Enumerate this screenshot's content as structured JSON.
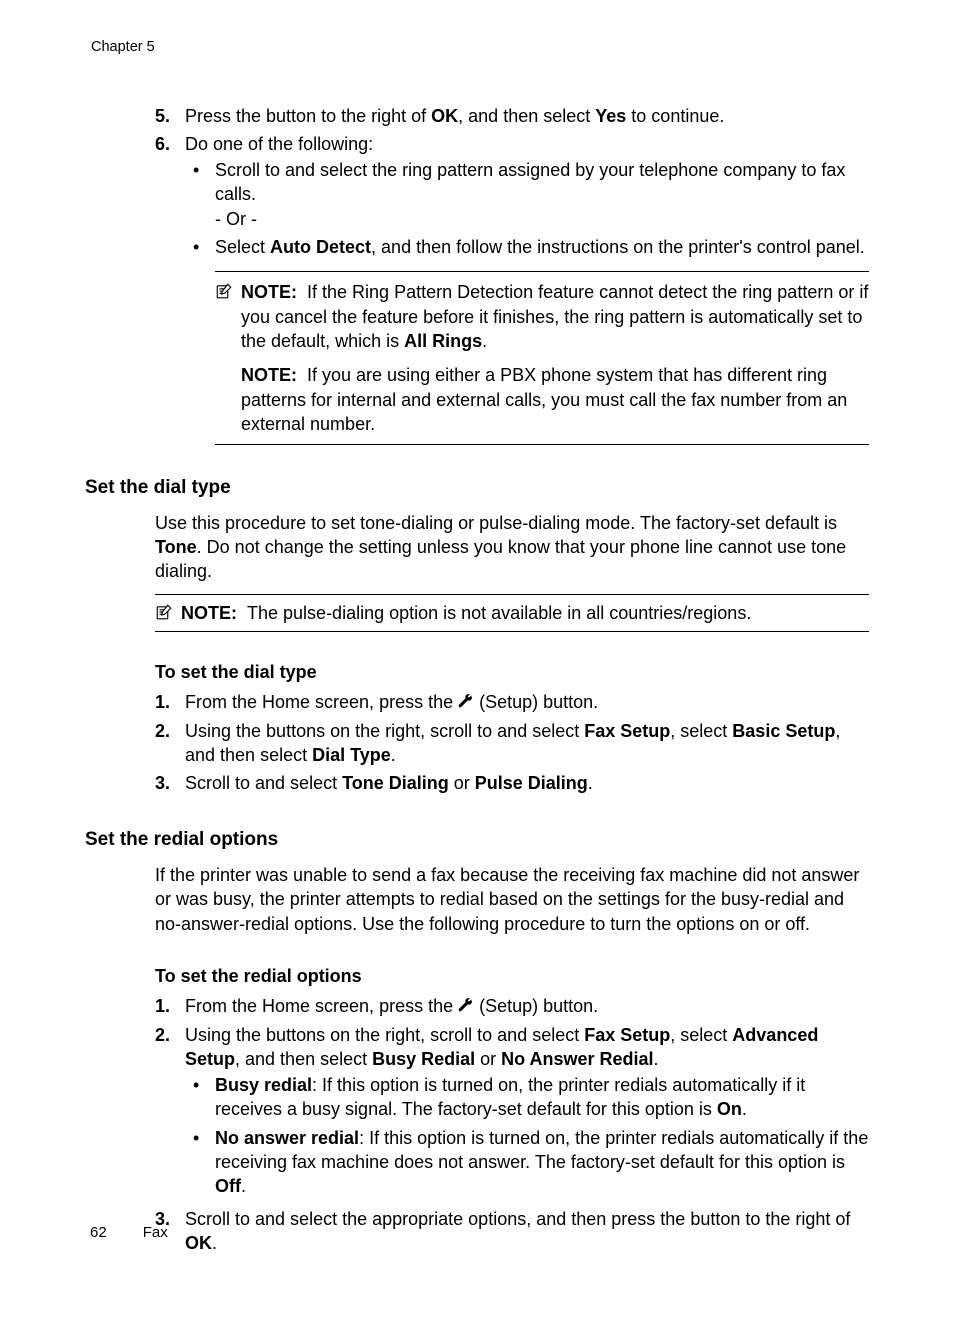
{
  "chapter": "Chapter 5",
  "steps_top": {
    "s5_num": "5.",
    "s5_a": "Press the button to the right of ",
    "s5_b": "OK",
    "s5_c": ", and then select ",
    "s5_d": "Yes",
    "s5_e": " to continue.",
    "s6_num": "6.",
    "s6_a": "Do one of the following:",
    "s6_b1": "Scroll to and select the ring pattern assigned by your telephone company to fax calls.",
    "s6_or": "- Or -",
    "s6_b2a": "Select ",
    "s6_b2b": "Auto Detect",
    "s6_b2c": ", and then follow the instructions on the printer's control panel."
  },
  "note1": {
    "label1": "NOTE:",
    "p1a": "If the Ring Pattern Detection feature cannot detect the ring pattern or if you cancel the feature before it finishes, the ring pattern is automatically set to the default, which is ",
    "p1b": "All Rings",
    "p1c": ".",
    "label2": "NOTE:",
    "p2": "If you are using either a PBX phone system that has different ring patterns for internal and external calls, you must call the fax number from an external number."
  },
  "dial": {
    "heading": "Set the dial type",
    "intro_a": "Use this procedure to set tone-dialing or pulse-dialing mode. The factory-set default is ",
    "intro_b": "Tone",
    "intro_c": ". Do not change the setting unless you know that your phone line cannot use tone dialing.",
    "note_label": "NOTE:",
    "note_text": "The pulse-dialing option is not available in all countries/regions.",
    "proc_title": "To set the dial type",
    "s1_num": "1.",
    "s1_a": "From the Home screen, press the ",
    "s1_b": " (Setup) button.",
    "s2_num": "2.",
    "s2_a": "Using the buttons on the right, scroll to and select ",
    "s2_b": "Fax Setup",
    "s2_c": ", select ",
    "s2_d": "Basic Setup",
    "s2_e": ", and then select ",
    "s2_f": "Dial Type",
    "s2_g": ".",
    "s3_num": "3.",
    "s3_a": "Scroll to and select ",
    "s3_b": "Tone Dialing",
    "s3_c": " or ",
    "s3_d": "Pulse Dialing",
    "s3_e": "."
  },
  "redial": {
    "heading": "Set the redial options",
    "intro": "If the printer was unable to send a fax because the receiving fax machine did not answer or was busy, the printer attempts to redial based on the settings for the busy-redial and no-answer-redial options. Use the following procedure to turn the options on or off.",
    "proc_title": "To set the redial options",
    "s1_num": "1.",
    "s1_a": "From the Home screen, press the ",
    "s1_b": " (Setup) button.",
    "s2_num": "2.",
    "s2_a": "Using the buttons on the right, scroll to and select ",
    "s2_b": "Fax Setup",
    "s2_c": ", select ",
    "s2_d": "Advanced Setup",
    "s2_e": ", and then select ",
    "s2_f": "Busy Redial",
    "s2_g": " or ",
    "s2_h": "No Answer Redial",
    "s2_i": ".",
    "b1_a": "Busy redial",
    "b1_b": ": If this option is turned on, the printer redials automatically if it receives a busy signal. The factory-set default for this option is ",
    "b1_c": "On",
    "b1_d": ".",
    "b2_a": "No answer redial",
    "b2_b": ": If this option is turned on, the printer redials automatically if the receiving fax machine does not answer. The factory-set default for this option is ",
    "b2_c": "Off",
    "b2_d": ".",
    "s3_num": "3.",
    "s3_a": "Scroll to and select the appropriate options, and then press the button to the right of ",
    "s3_b": "OK",
    "s3_c": "."
  },
  "footer": {
    "page": "62",
    "section": "Fax"
  }
}
